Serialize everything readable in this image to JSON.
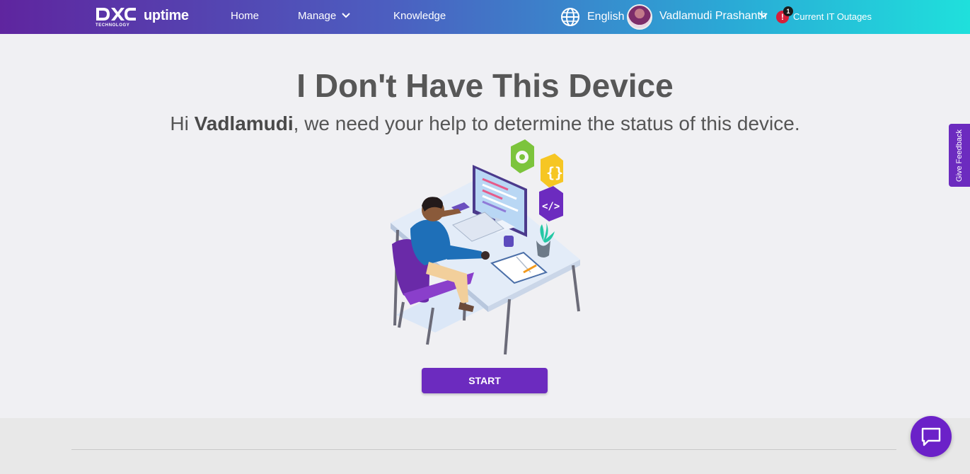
{
  "header": {
    "brand_wordmark": "DXC",
    "brand_sub": "TECHNOLOGY",
    "product": "uptime",
    "nav": {
      "home": "Home",
      "manage": "Manage",
      "knowledge": "Knowledge"
    },
    "language": "English",
    "user_name": "Vadlamudi Prashanth",
    "alert_count": "1",
    "alert_symbol": "!",
    "outages_label": "Current IT Outages"
  },
  "main": {
    "title": "I Don't Have This Device",
    "greeting_prefix": "Hi ",
    "greeting_name": "Vadlamudi",
    "greeting_suffix": ", we need your help to determine the status of this device.",
    "start_button": "START"
  },
  "feedback_tab": "Give Feedback",
  "colors": {
    "accent_purple": "#6c2bbf",
    "header_gradient_start": "#5f259f",
    "header_gradient_end": "#1fe0dc",
    "alert_red": "#d61f3a"
  },
  "icons": {
    "globe": "globe-icon",
    "manage_chevron": "chevron-down-icon",
    "user_chevron": "chevron-down-icon",
    "alert": "alert-icon",
    "chat": "chat-bubble-icon"
  }
}
